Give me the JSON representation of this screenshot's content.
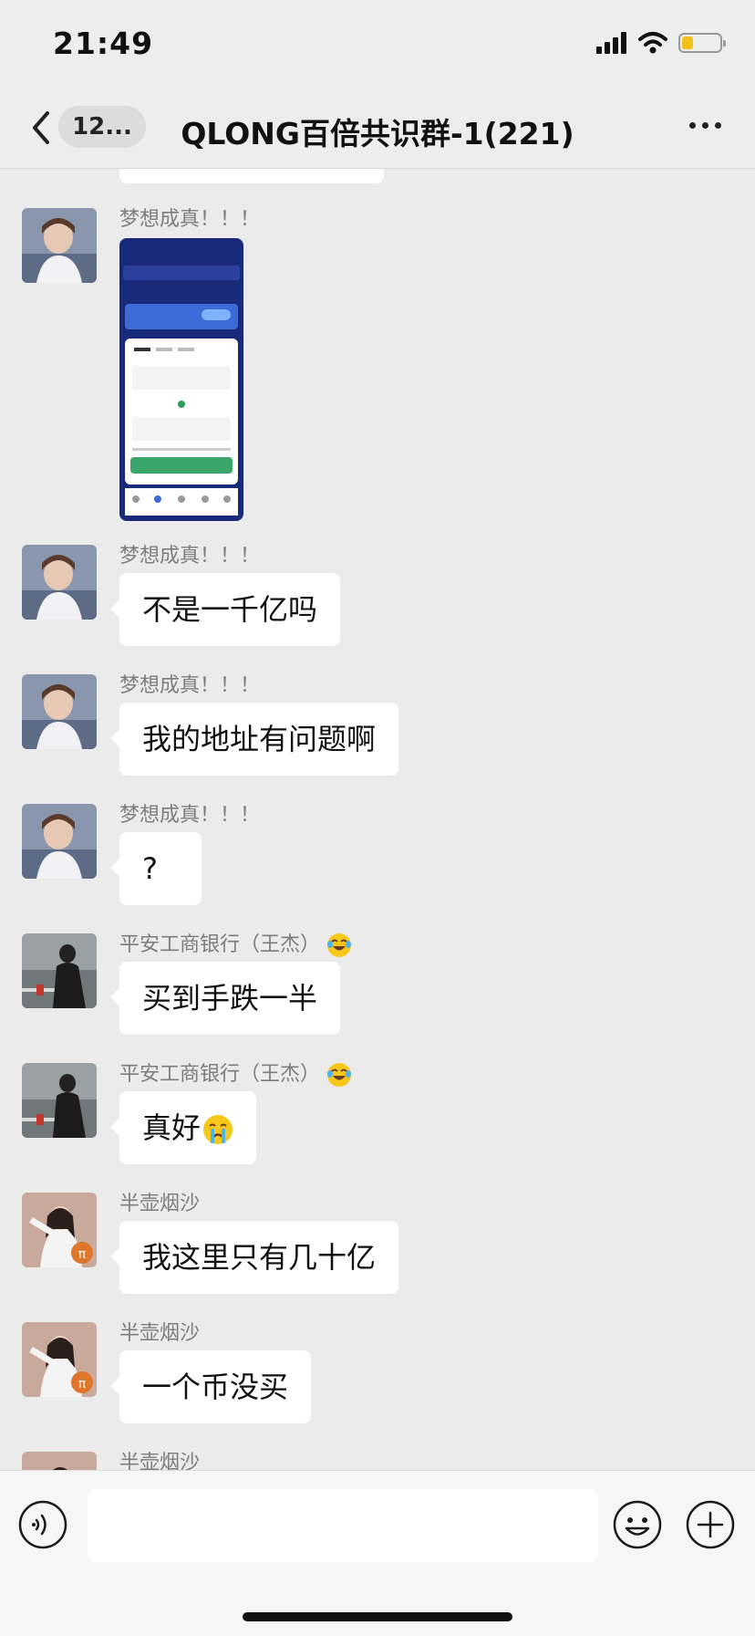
{
  "status_bar": {
    "time": "21:49",
    "battery_level": 0.3,
    "battery_color": "#f2c11b"
  },
  "nav": {
    "unread_count": "12...",
    "title": "QLONG百倍共识群-1(221)"
  },
  "messages": [
    {
      "sender": "梦想成真！！！",
      "type": "image"
    },
    {
      "sender": "梦想成真！！！",
      "text": "不是一千亿吗"
    },
    {
      "sender": "梦想成真！！！",
      "text": "我的地址有问题啊"
    },
    {
      "sender": "梦想成真！！！",
      "text": "?"
    },
    {
      "sender": "平安工商银行（王杰）",
      "sender_emoji": "laughing-tears-emoji",
      "text": "买到手跌一半"
    },
    {
      "sender": "平安工商银行（王杰）",
      "sender_emoji": "laughing-tears-emoji",
      "text": "真好",
      "text_emoji": "crying-face-emoji"
    },
    {
      "sender": "半壶烟沙",
      "text": "我这里只有几十亿"
    },
    {
      "sender": "半壶烟沙",
      "text": "一个币没买"
    },
    {
      "sender": "半壶烟沙",
      "text": ""
    }
  ],
  "input": {
    "value": "",
    "placeholder": ""
  },
  "colors": {
    "page_bg": "#ebebeb",
    "bubble_bg": "#ffffff",
    "sender_text": "#7d7d7d",
    "nav_bg": "#ededed"
  }
}
